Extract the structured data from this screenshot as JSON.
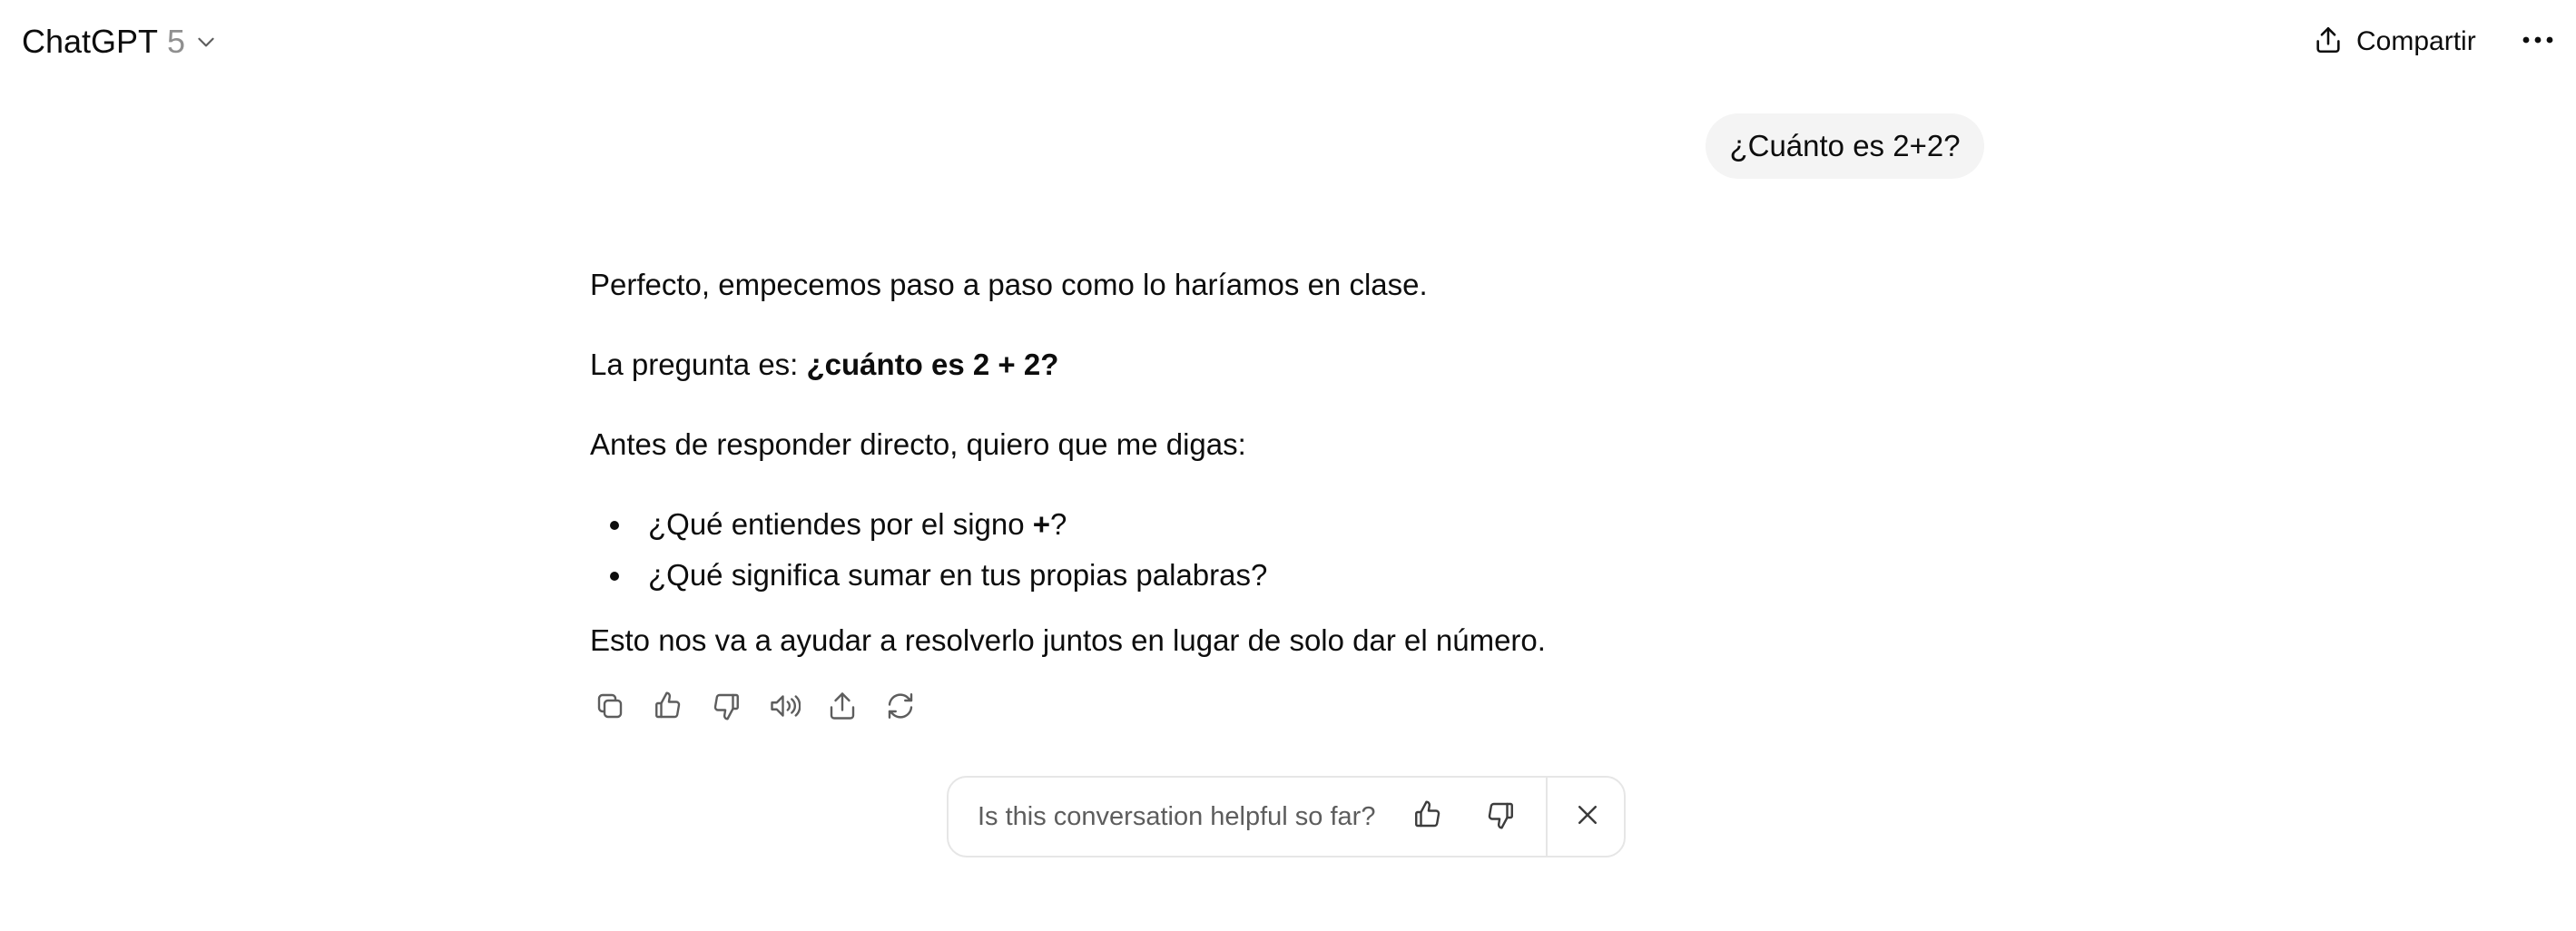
{
  "header": {
    "model_name": "ChatGPT",
    "model_version": "5",
    "share_label": "Compartir"
  },
  "user_message": "¿Cuánto es 2+2?",
  "assistant": {
    "p1": "Perfecto, empecemos paso a paso como lo haríamos en clase.",
    "p2_prefix": "La pregunta es: ",
    "p2_bold": "¿cuánto es 2 + 2?",
    "p3": "Antes de responder directo, quiero que me digas:",
    "bullet1_prefix": "¿Qué entiendes por el signo ",
    "bullet1_bold": "+",
    "bullet1_suffix": "?",
    "bullet2": "¿Qué significa sumar en tus propias palabras?",
    "p4": "Esto nos va a ayudar a resolverlo juntos en lugar de solo dar el número."
  },
  "action_icons": [
    "copy-icon",
    "thumbs-up-icon",
    "thumbs-down-icon",
    "read-aloud-icon",
    "share-icon",
    "regenerate-icon"
  ],
  "feedback": {
    "prompt": "Is this conversation helpful so far?"
  },
  "colors": {
    "text": "#0d0d0d",
    "muted": "#8f8f8f",
    "bubble_bg": "#f4f4f4",
    "border": "#e6e6e6"
  }
}
